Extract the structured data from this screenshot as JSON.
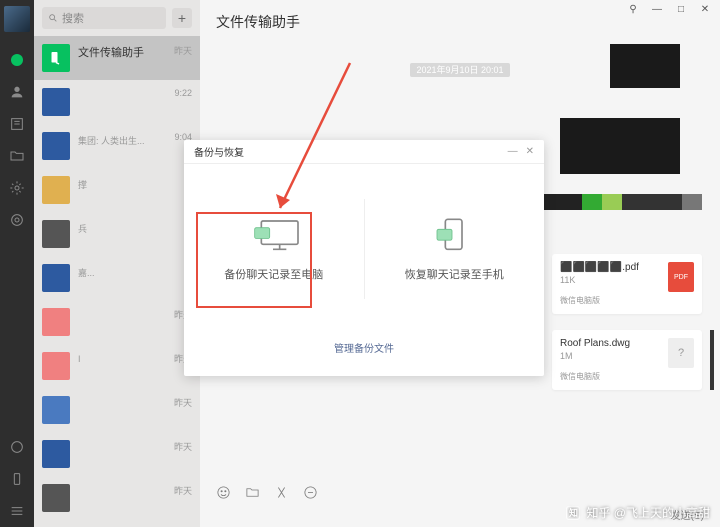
{
  "window": {
    "pin": "⚲",
    "min": "—",
    "max": "□",
    "close": "✕"
  },
  "search": {
    "placeholder": "搜索"
  },
  "header": {
    "title": "文件传输助手"
  },
  "nav": [
    "chat",
    "contacts",
    "favorites",
    "files",
    "settings",
    "apps"
  ],
  "chats": [
    {
      "name": "文件传输助手",
      "time": "昨天",
      "av": "c1"
    },
    {
      "name": "",
      "time": "9:22",
      "av": "c2"
    },
    {
      "name": "",
      "time": "9:04",
      "av": "c2",
      "sub": "集团: 人类出生..."
    },
    {
      "name": "",
      "time": "",
      "av": "c3",
      "sub": "撑"
    },
    {
      "name": "",
      "time": "",
      "av": "c4",
      "sub": "兵"
    },
    {
      "name": "",
      "time": "",
      "av": "c2",
      "sub": "嘉..."
    },
    {
      "name": "",
      "time": "昨天",
      "av": "c5"
    },
    {
      "name": "",
      "time": "昨天",
      "av": "c5",
      "sub": "I"
    },
    {
      "name": "",
      "time": "昨天",
      "av": "c6"
    },
    {
      "name": "",
      "time": "昨天",
      "av": "c2"
    },
    {
      "name": "",
      "time": "昨天",
      "av": "c4"
    }
  ],
  "timestamp": "2021年9月10日 20:01",
  "dialog": {
    "title": "备份与恢复",
    "backup": "备份聊天记录至电脑",
    "restore": "恢复聊天记录至手机",
    "manage": "管理备份文件"
  },
  "files": {
    "f1": {
      "size": "11K",
      "src": "微信电脑版",
      "ext": "PDF"
    },
    "f2": {
      "name": "Roof Plans.dwg",
      "size": "1M",
      "src": "微信电脑版"
    }
  },
  "send": "发送(S)",
  "watermark": {
    "logo": "知",
    "text": "知乎 @飞上天的小高甜"
  }
}
